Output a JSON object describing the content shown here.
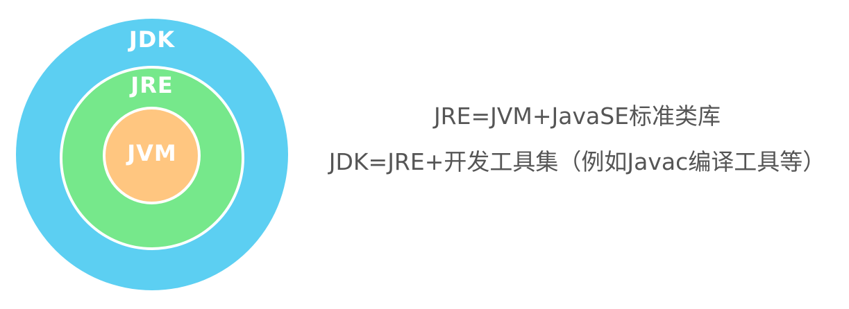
{
  "diagram": {
    "outer_label": "JDK",
    "middle_label": "JRE",
    "inner_label": "JVM",
    "colors": {
      "jdk": "#5ccff2",
      "jre": "#76e88b",
      "jvm": "#ffc680",
      "label": "#ffffff"
    }
  },
  "text": {
    "line1": "JRE=JVM+JavaSE标准类库",
    "line2": "JDK=JRE+开发工具集（例如Javac编译工具等）",
    "color": "#555555"
  }
}
